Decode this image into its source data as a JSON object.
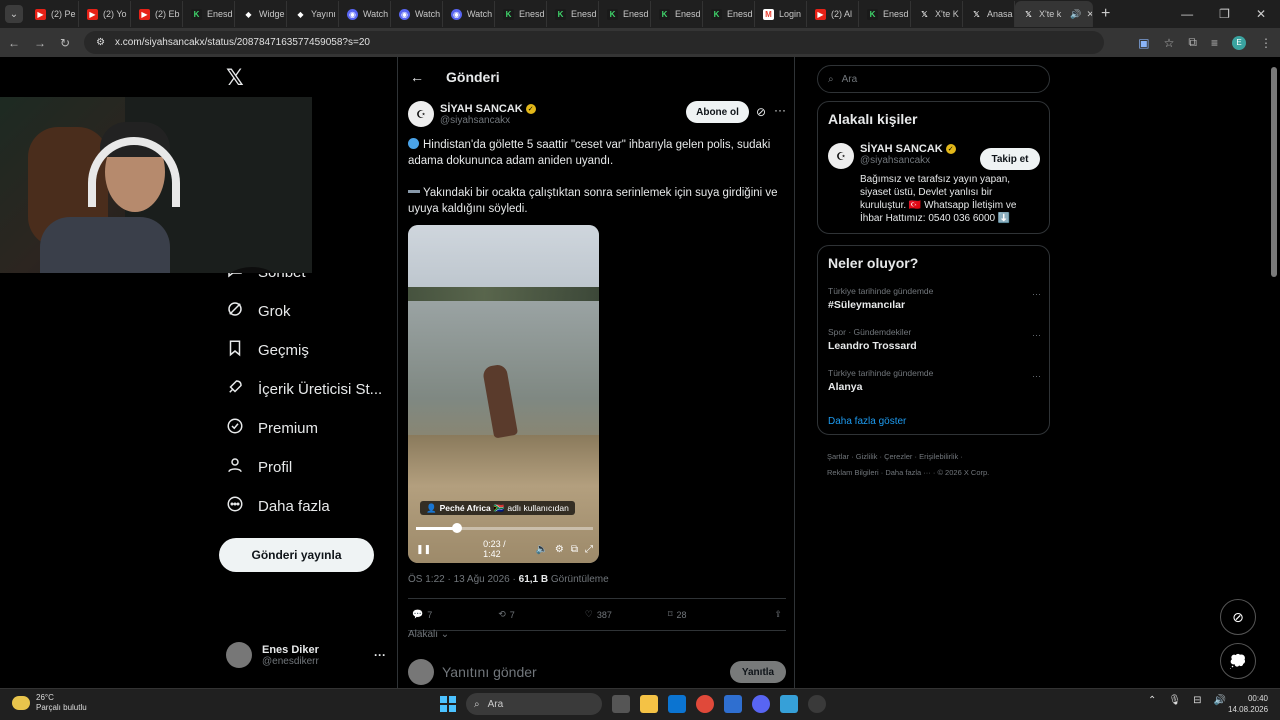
{
  "browser": {
    "tabs": [
      {
        "label": "(2) Pe",
        "icon": "youtube-icon"
      },
      {
        "label": "(2) Yo",
        "icon": "youtube-icon"
      },
      {
        "label": "(2) Eb",
        "icon": "youtube-icon"
      },
      {
        "label": "Enesd",
        "icon": "enesd-icon"
      },
      {
        "label": "Widge",
        "icon": "widget-icon"
      },
      {
        "label": "Yayını",
        "icon": "widget-icon"
      },
      {
        "label": "Watch",
        "icon": "discord-icon"
      },
      {
        "label": "Watch",
        "icon": "discord-icon"
      },
      {
        "label": "Watch",
        "icon": "discord-icon"
      },
      {
        "label": "Enesd",
        "icon": "enesd-icon"
      },
      {
        "label": "Enesd",
        "icon": "enesd-icon"
      },
      {
        "label": "Enesd",
        "icon": "enesd-icon"
      },
      {
        "label": "Enesd",
        "icon": "enesd-icon"
      },
      {
        "label": "Enesd",
        "icon": "enesd-icon"
      },
      {
        "label": "Login",
        "icon": "gmail-icon"
      },
      {
        "label": "(2) Al",
        "icon": "youtube-icon"
      },
      {
        "label": "Enesd",
        "icon": "enesd-icon"
      },
      {
        "label": "X'te K",
        "icon": "x-icon"
      },
      {
        "label": "Anasa",
        "icon": "x-icon"
      },
      {
        "label": "X'te k",
        "icon": "x-icon"
      }
    ],
    "url": "x.com/siyahsancakx/status/2087847163577459058?s=20",
    "profile_initial": "E"
  },
  "leftnav": {
    "items": [
      {
        "label": "Sohbet",
        "icon": "chat-icon"
      },
      {
        "label": "Grok",
        "icon": "grok-icon"
      },
      {
        "label": "Geçmiş",
        "icon": "bookmark-icon"
      },
      {
        "label": "İçerik Üreticisi St...",
        "icon": "rocket-icon"
      },
      {
        "label": "Premium",
        "icon": "verified-icon"
      },
      {
        "label": "Profil",
        "icon": "profile-icon"
      },
      {
        "label": "Daha fazla",
        "icon": "more-circle-icon"
      }
    ],
    "post_button": "Gönderi yayınla",
    "user": {
      "name": "Enes Diker",
      "handle": "@enesdikerr"
    }
  },
  "main": {
    "title": "Gönderi",
    "author": {
      "name": "SİYAH SANCAK",
      "handle": "@siyahsancakx"
    },
    "subscribe_button": "Abone ol",
    "text_1": "Hindistan'da gölette 5 saattir \"ceset var\" ihbarıyla gelen polis, sudaki adama dokununca adam aniden uyandı.",
    "text_2": "Yakındaki bir ocakta çalıştıktan sonra serinlemek için suya girdiğini ve uyuya kaldığını söyledi.",
    "video": {
      "tag_name": "Peché Africa",
      "tag_suffix": "adlı kullanıcıdan",
      "time": "0:23 / 1:42",
      "progress": 0.23
    },
    "meta_time": "ÖS 1:22 · 13 Ağu 2026 · ",
    "meta_views": "61,1 B",
    "meta_views_label": " Görüntüleme",
    "stats": {
      "replies": "7",
      "reposts": "7",
      "likes": "387",
      "bookmarks": "28"
    },
    "relevant": "Alakalı",
    "reply_placeholder": "Yanıtını gönder",
    "reply_button": "Yanıtla"
  },
  "right": {
    "search_placeholder": "Ara",
    "people_title": "Alakalı kişiler",
    "person": {
      "name": "SİYAH SANCAK",
      "handle": "@siyahsancakx",
      "follow_button": "Takip et",
      "bio": "Bağımsız ve tarafsız yayın yapan, siyaset üstü, Devlet yanlısı bir kuruluştur. 🇹🇷 Whatsapp İletişim ve İhbar Hattımız: 0540 036 6000 ⬇️"
    },
    "trends_title": "Neler oluyor?",
    "trends": [
      {
        "category": "Türkiye tarihinde gündemde",
        "title": "#Süleymancılar"
      },
      {
        "category": "Spor · Gündemdekiler",
        "title": "Leandro Trossard"
      },
      {
        "category": "Türkiye tarihinde gündemde",
        "title": "Alanya"
      }
    ],
    "show_more": "Daha fazla göster",
    "footer_line1": "Şartlar  ·  Gizlilik  ·  Çerezler  ·  Erişilebilirlik  ·",
    "footer_line2": "Reklam Bilgileri  ·  Daha fazla ···  ·  © 2026 X Corp."
  },
  "taskbar": {
    "weather_temp": "26°C",
    "weather_desc": "Parçalı bulutlu",
    "search_label": "Ara",
    "time": "00:40",
    "date": "14.08.2026"
  },
  "colors": {
    "accent": "#1d9bf0",
    "verified": "#e2b719",
    "background": "#000000"
  }
}
